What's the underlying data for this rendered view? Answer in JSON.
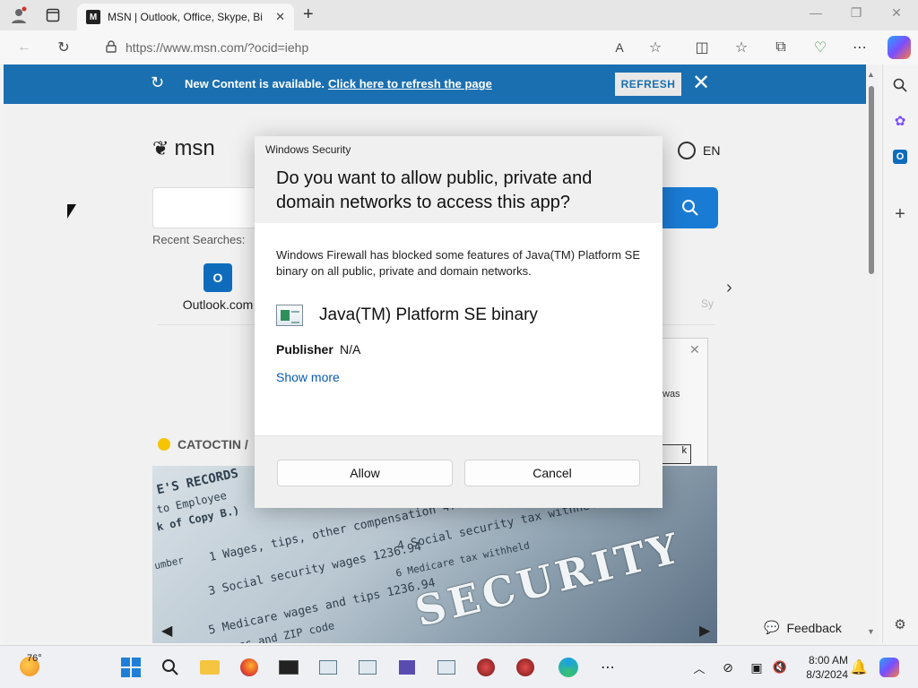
{
  "browser": {
    "tab_title": "MSN | Outlook, Office, Skype, Bi",
    "tab_favicon": "M",
    "url": "https://www.msn.com/?ocid=iehp"
  },
  "banner": {
    "message": "New Content is available.",
    "link": "Click here to refresh the page",
    "button": "REFRESH"
  },
  "msn": {
    "logo_text": "msn",
    "language": "EN",
    "recent_label": "Recent Searches:",
    "tile_label": "Outlook.com",
    "tile_faded": "Sy",
    "weather_location": "CATOCTIN /",
    "feedback": "Feedback"
  },
  "hero": {
    "line1": "E'S RECORDS",
    "line2": "to Employee",
    "line3": "k of Copy B.)",
    "line4": "1  Wages, tips, other compensation   4772.36",
    "line5": "3  Social security wages   1236.94",
    "line6": "5  Medicare wages and tips   1236.94",
    "line7": "4  Social security tax withheld   2151.50",
    "line8": "6  Medicare tax withheld",
    "line9": "umber",
    "line10": "address and ZIP code",
    "security": "SECURITY"
  },
  "bg_dialog": {
    "text": "was",
    "button": "k"
  },
  "modal": {
    "app": "Windows Security",
    "question": "Do you want to allow public, private and domain networks to access this app?",
    "body": "Windows Firewall has blocked some features of Java(TM) Platform SE binary on all public, private and domain networks.",
    "app_name": "Java(TM) Platform SE binary",
    "publisher_label": "Publisher",
    "publisher_value": "N/A",
    "show_more": "Show more",
    "allow": "Allow",
    "cancel": "Cancel"
  },
  "taskbar": {
    "temperature": "76°",
    "time": "8:00 AM",
    "date": "8/3/2024"
  }
}
